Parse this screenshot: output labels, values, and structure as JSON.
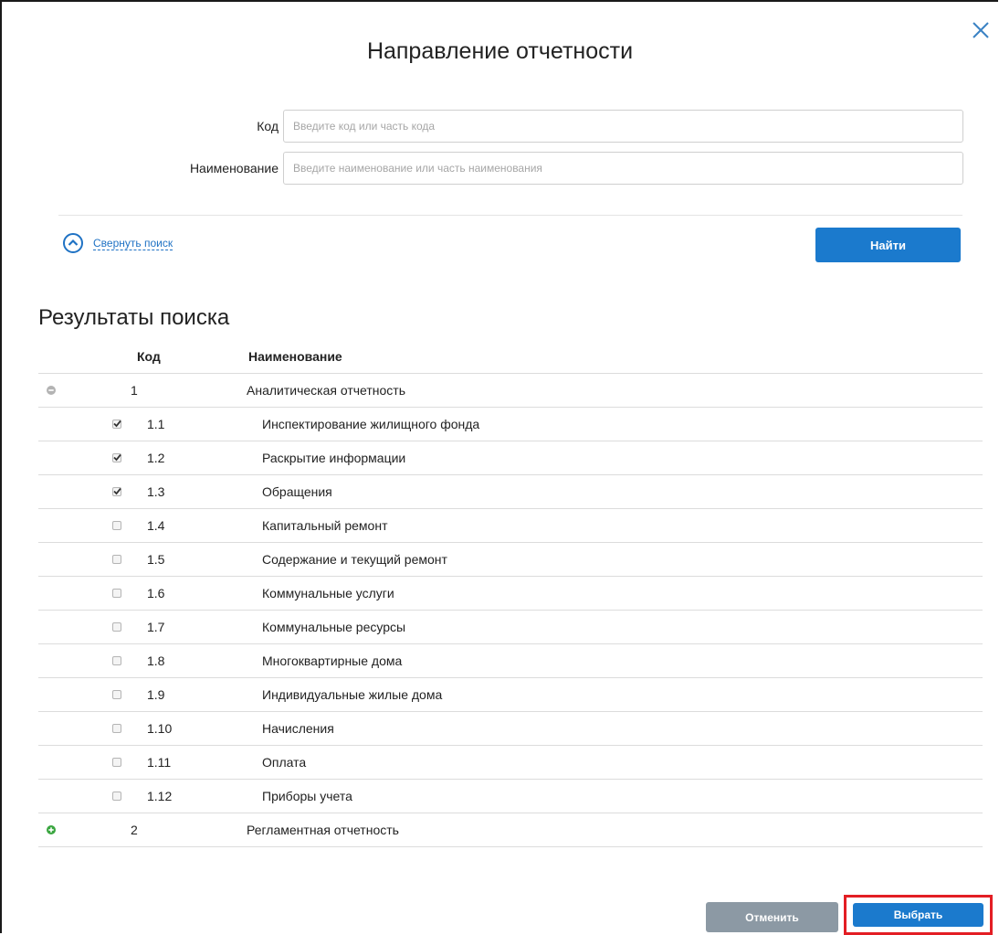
{
  "dialog": {
    "title": "Направление отчетности",
    "close_icon": "close-icon"
  },
  "search": {
    "code_label": "Код",
    "code_placeholder": "Введите код или часть кода",
    "code_value": "",
    "name_label": "Наименование",
    "name_placeholder": "Введите наименование или часть наименования",
    "name_value": "",
    "collapse_label": "Свернуть поиск",
    "find_button": "Найти"
  },
  "results": {
    "title": "Результаты поиска",
    "columns": {
      "code": "Код",
      "name": "Наименование"
    },
    "rows": [
      {
        "type": "parent",
        "expanded": true,
        "code": "1",
        "name": "Аналитическая отчетность"
      },
      {
        "type": "child",
        "checked": true,
        "code": "1.1",
        "name": "Инспектирование жилищного фонда"
      },
      {
        "type": "child",
        "checked": true,
        "code": "1.2",
        "name": "Раскрытие информации"
      },
      {
        "type": "child",
        "checked": true,
        "code": "1.3",
        "name": "Обращения"
      },
      {
        "type": "child",
        "checked": false,
        "code": "1.4",
        "name": "Капитальный ремонт"
      },
      {
        "type": "child",
        "checked": false,
        "code": "1.5",
        "name": "Содержание и текущий ремонт"
      },
      {
        "type": "child",
        "checked": false,
        "code": "1.6",
        "name": "Коммунальные услуги"
      },
      {
        "type": "child",
        "checked": false,
        "code": "1.7",
        "name": "Коммунальные ресурсы"
      },
      {
        "type": "child",
        "checked": false,
        "code": "1.8",
        "name": "Многоквартирные дома"
      },
      {
        "type": "child",
        "checked": false,
        "code": "1.9",
        "name": "Индивидуальные жилые дома"
      },
      {
        "type": "child",
        "checked": false,
        "code": "1.10",
        "name": "Начисления"
      },
      {
        "type": "child",
        "checked": false,
        "code": "1.11",
        "name": "Оплата"
      },
      {
        "type": "child",
        "checked": false,
        "code": "1.12",
        "name": "Приборы учета"
      },
      {
        "type": "parent",
        "expanded": false,
        "code": "2",
        "name": "Регламентная отчетность"
      }
    ]
  },
  "footer": {
    "cancel_button": "Отменить",
    "select_button": "Выбрать"
  },
  "colors": {
    "primary": "#1b7acd",
    "link": "#1f72c4",
    "cancel": "#8c99a4",
    "highlight": "#e31e24",
    "expand_green": "#3aa640",
    "collapse_gray": "#b3b3b3"
  }
}
